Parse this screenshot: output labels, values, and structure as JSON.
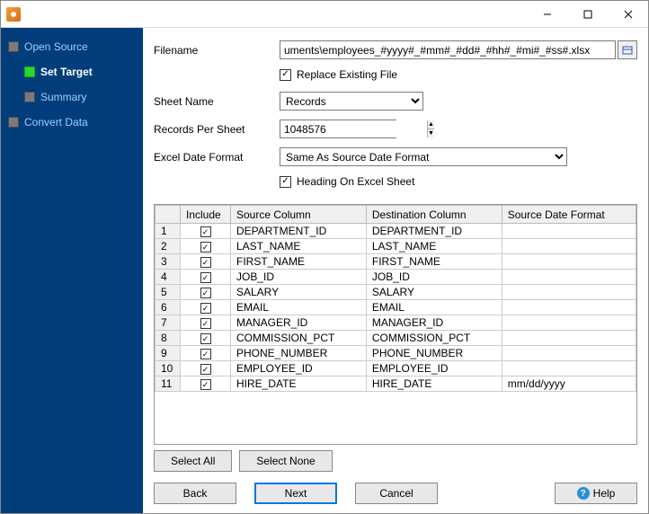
{
  "titlebar": {
    "title": ""
  },
  "sidebar": {
    "items": [
      {
        "label": "Open Source",
        "active": false,
        "indent": false
      },
      {
        "label": "Set Target",
        "active": true,
        "indent": true
      },
      {
        "label": "Summary",
        "active": false,
        "indent": true
      },
      {
        "label": "Convert Data",
        "active": false,
        "indent": false
      }
    ]
  },
  "form": {
    "filename_label": "Filename",
    "filename_value": "uments\\employees_#yyyy#_#mm#_#dd#_#hh#_#mi#_#ss#.xlsx",
    "replace_existing_label": "Replace Existing File",
    "replace_existing_checked": true,
    "sheetname_label": "Sheet Name",
    "sheetname_value": "Records",
    "records_label": "Records Per Sheet",
    "records_value": "1048576",
    "dateformat_label": "Excel Date Format",
    "dateformat_value": "Same As Source Date Format",
    "heading_label": "Heading On Excel Sheet",
    "heading_checked": true
  },
  "table": {
    "headers": {
      "rownum": "",
      "include": "Include",
      "source": "Source Column",
      "dest": "Destination Column",
      "datefmt": "Source Date Format"
    },
    "rows": [
      {
        "n": "1",
        "inc": true,
        "src": "DEPARTMENT_ID",
        "dst": "DEPARTMENT_ID",
        "fmt": ""
      },
      {
        "n": "2",
        "inc": true,
        "src": "LAST_NAME",
        "dst": "LAST_NAME",
        "fmt": ""
      },
      {
        "n": "3",
        "inc": true,
        "src": "FIRST_NAME",
        "dst": "FIRST_NAME",
        "fmt": ""
      },
      {
        "n": "4",
        "inc": true,
        "src": "JOB_ID",
        "dst": "JOB_ID",
        "fmt": ""
      },
      {
        "n": "5",
        "inc": true,
        "src": "SALARY",
        "dst": "SALARY",
        "fmt": ""
      },
      {
        "n": "6",
        "inc": true,
        "src": "EMAIL",
        "dst": "EMAIL",
        "fmt": ""
      },
      {
        "n": "7",
        "inc": true,
        "src": "MANAGER_ID",
        "dst": "MANAGER_ID",
        "fmt": ""
      },
      {
        "n": "8",
        "inc": true,
        "src": "COMMISSION_PCT",
        "dst": "COMMISSION_PCT",
        "fmt": ""
      },
      {
        "n": "9",
        "inc": true,
        "src": "PHONE_NUMBER",
        "dst": "PHONE_NUMBER",
        "fmt": ""
      },
      {
        "n": "10",
        "inc": true,
        "src": "EMPLOYEE_ID",
        "dst": "EMPLOYEE_ID",
        "fmt": ""
      },
      {
        "n": "11",
        "inc": true,
        "src": "HIRE_DATE",
        "dst": "HIRE_DATE",
        "fmt": "mm/dd/yyyy"
      }
    ]
  },
  "buttons": {
    "select_all": "Select All",
    "select_none": "Select None",
    "back": "Back",
    "next": "Next",
    "cancel": "Cancel",
    "help": "Help"
  }
}
